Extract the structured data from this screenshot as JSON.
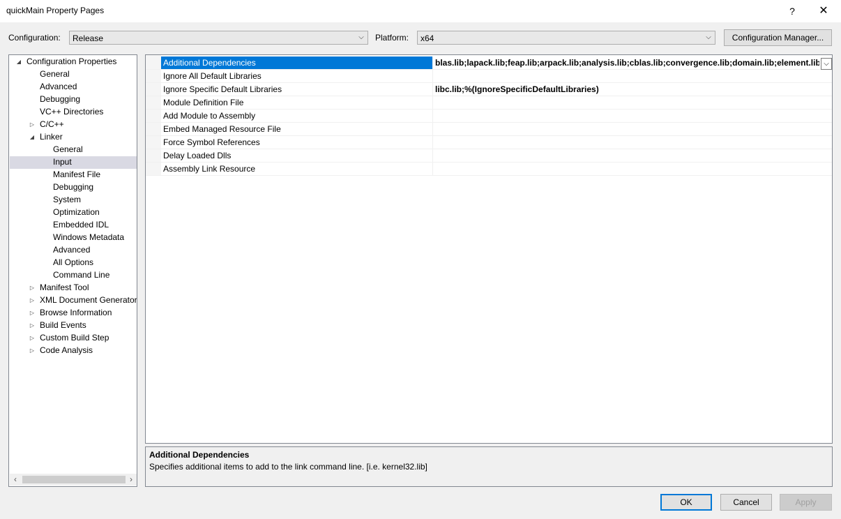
{
  "window": {
    "title": "quickMain Property Pages",
    "help": "?",
    "close": "✕"
  },
  "toolbar": {
    "configuration_label": "Configuration:",
    "configuration_value": "Release",
    "platform_label": "Platform:",
    "platform_value": "x64",
    "config_manager_label": "Configuration Manager..."
  },
  "tree": {
    "root": "Configuration Properties",
    "items": [
      "General",
      "Advanced",
      "Debugging",
      "VC++ Directories",
      "C/C++",
      "Linker",
      "General",
      "Input",
      "Manifest File",
      "Debugging",
      "System",
      "Optimization",
      "Embedded IDL",
      "Windows Metadata",
      "Advanced",
      "All Options",
      "Command Line",
      "Manifest Tool",
      "XML Document Generator",
      "Browse Information",
      "Build Events",
      "Custom Build Step",
      "Code Analysis"
    ],
    "selected": "Input"
  },
  "grid": {
    "rows": [
      {
        "name": "Additional Dependencies",
        "value": "blas.lib;lapack.lib;feap.lib;arpack.lib;analysis.lib;cblas.lib;convergence.lib;domain.lib;element.lib;graph.lib"
      },
      {
        "name": "Ignore All Default Libraries",
        "value": ""
      },
      {
        "name": "Ignore Specific Default Libraries",
        "value": "libc.lib;%(IgnoreSpecificDefaultLibraries)"
      },
      {
        "name": "Module Definition File",
        "value": ""
      },
      {
        "name": "Add Module to Assembly",
        "value": ""
      },
      {
        "name": "Embed Managed Resource File",
        "value": ""
      },
      {
        "name": "Force Symbol References",
        "value": ""
      },
      {
        "name": "Delay Loaded Dlls",
        "value": ""
      },
      {
        "name": "Assembly Link Resource",
        "value": ""
      }
    ]
  },
  "description": {
    "title": "Additional Dependencies",
    "text": "Specifies additional items to add to the link command line. [i.e. kernel32.lib]"
  },
  "buttons": {
    "ok": "OK",
    "cancel": "Cancel",
    "apply": "Apply"
  },
  "colors": {
    "selection": "#0078d7",
    "tree_selection": "#d9d9e3"
  }
}
